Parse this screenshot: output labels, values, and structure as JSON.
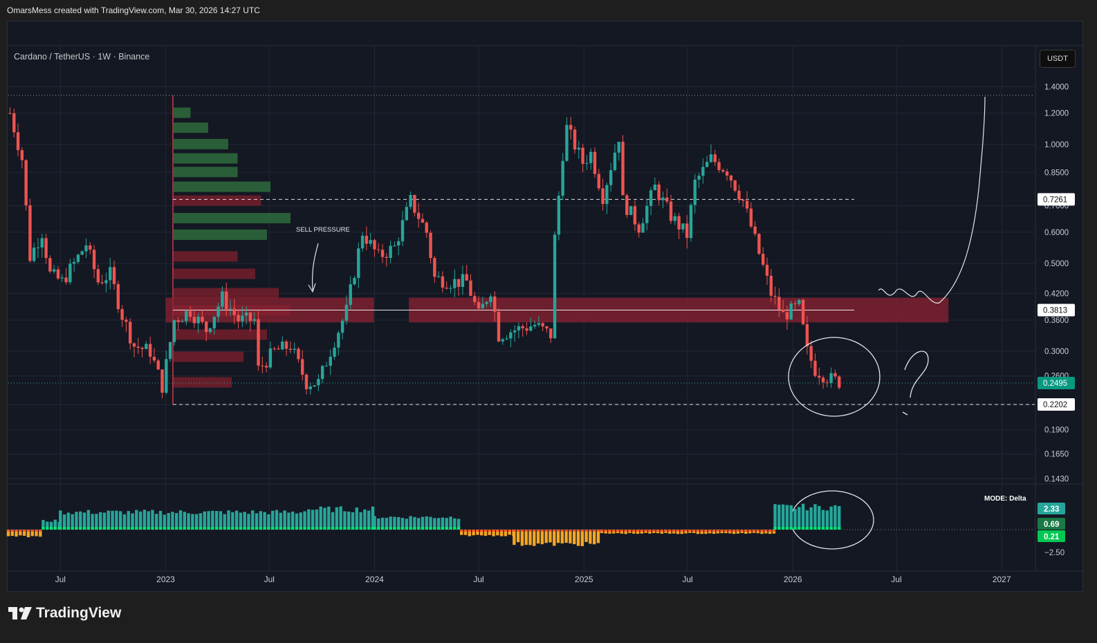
{
  "header": {
    "credit": "OmarsMess created with TradingView.com, Mar 30, 2026 14:27 UTC"
  },
  "symbol": {
    "description": "Cardano / TetherUS · 1W · Binance",
    "currency": "USDT"
  },
  "footer": {
    "brand": "TradingView",
    "logo_icon": "tradingview-logo-icon"
  },
  "colors": {
    "up": "#26a69a",
    "down": "#ef5350",
    "grid": "#232734",
    "zone": "#8b2231",
    "vp_up": "#2e6b3c",
    "vp_down": "#7a1f2c",
    "label_green": "#089981",
    "delta_bright": "#00e676"
  },
  "chart_data": {
    "type": "candlestick",
    "scale": "log",
    "grid": true,
    "symbol": "Cardano / TetherUS",
    "interval": "1W",
    "exchange": "Binance",
    "price_axis_ticks": [
      "1.4000",
      "1.2000",
      "1.0000",
      "0.8500",
      "0.7000",
      "0.6000",
      "0.5000",
      "0.4200",
      "0.3600",
      "0.3000",
      "0.2600",
      "0.2200",
      "0.1900",
      "0.1650",
      "0.1430"
    ],
    "time_axis_labels": [
      {
        "label": "Jul",
        "date": "2022-07"
      },
      {
        "label": "2023",
        "date": "2023-01"
      },
      {
        "label": "Jul",
        "date": "2023-07"
      },
      {
        "label": "2024",
        "date": "2024-01"
      },
      {
        "label": "Jul",
        "date": "2024-07"
      },
      {
        "label": "2025",
        "date": "2025-01"
      },
      {
        "label": "Jul",
        "date": "2025-07"
      },
      {
        "label": "2026",
        "date": "2026-01"
      },
      {
        "label": "Jul",
        "date": "2026-07"
      },
      {
        "label": "2027",
        "date": "2027-01"
      }
    ],
    "price_labels": [
      {
        "value": "0.7261",
        "style": "line"
      },
      {
        "value": "0.3813",
        "style": "line"
      },
      {
        "value": "0.2495",
        "style": "current"
      },
      {
        "value": "0.2202",
        "style": "line"
      }
    ],
    "weekly_close": [
      {
        "x": "2022-04-04",
        "close": 1.2
      },
      {
        "x": "2022-04-25",
        "close": 0.92
      },
      {
        "x": "2022-05-09",
        "close": 0.52
      },
      {
        "x": "2022-05-30",
        "close": 0.6
      },
      {
        "x": "2022-06-13",
        "close": 0.47
      },
      {
        "x": "2022-07-04",
        "close": 0.45
      },
      {
        "x": "2022-07-25",
        "close": 0.5
      },
      {
        "x": "2022-08-15",
        "close": 0.56
      },
      {
        "x": "2022-09-05",
        "close": 0.45
      },
      {
        "x": "2022-09-26",
        "close": 0.47
      },
      {
        "x": "2022-10-17",
        "close": 0.37
      },
      {
        "x": "2022-11-07",
        "close": 0.31
      },
      {
        "x": "2022-12-05",
        "close": 0.3
      },
      {
        "x": "2022-12-26",
        "close": 0.245
      },
      {
        "x": "2023-01-16",
        "close": 0.36
      },
      {
        "x": "2023-02-13",
        "close": 0.38
      },
      {
        "x": "2023-03-13",
        "close": 0.34
      },
      {
        "x": "2023-04-10",
        "close": 0.41
      },
      {
        "x": "2023-05-08",
        "close": 0.36
      },
      {
        "x": "2023-06-05",
        "close": 0.36
      },
      {
        "x": "2023-06-12",
        "close": 0.27
      },
      {
        "x": "2023-07-10",
        "close": 0.3
      },
      {
        "x": "2023-08-07",
        "close": 0.31
      },
      {
        "x": "2023-09-04",
        "close": 0.25
      },
      {
        "x": "2023-09-25",
        "close": 0.25
      },
      {
        "x": "2023-10-23",
        "close": 0.32
      },
      {
        "x": "2023-11-13",
        "close": 0.38
      },
      {
        "x": "2023-12-11",
        "close": 0.6
      },
      {
        "x": "2024-01-08",
        "close": 0.52
      },
      {
        "x": "2024-02-05",
        "close": 0.55
      },
      {
        "x": "2024-03-04",
        "close": 0.72
      },
      {
        "x": "2024-04-01",
        "close": 0.6
      },
      {
        "x": "2024-04-15",
        "close": 0.46
      },
      {
        "x": "2024-05-13",
        "close": 0.45
      },
      {
        "x": "2024-06-10",
        "close": 0.45
      },
      {
        "x": "2024-07-01",
        "close": 0.37
      },
      {
        "x": "2024-07-22",
        "close": 0.43
      },
      {
        "x": "2024-08-05",
        "close": 0.33
      },
      {
        "x": "2024-09-02",
        "close": 0.34
      },
      {
        "x": "2024-10-07",
        "close": 0.35
      },
      {
        "x": "2024-11-04",
        "close": 0.33
      },
      {
        "x": "2024-11-11",
        "close": 0.58
      },
      {
        "x": "2024-11-25",
        "close": 0.95
      },
      {
        "x": "2024-12-02",
        "close": 1.1
      },
      {
        "x": "2024-12-30",
        "close": 0.9
      },
      {
        "x": "2025-01-13",
        "close": 0.95
      },
      {
        "x": "2025-02-03",
        "close": 0.74
      },
      {
        "x": "2025-03-03",
        "close": 1.05
      },
      {
        "x": "2025-03-10",
        "close": 0.72
      },
      {
        "x": "2025-04-07",
        "close": 0.62
      },
      {
        "x": "2025-05-05",
        "close": 0.78
      },
      {
        "x": "2025-06-02",
        "close": 0.66
      },
      {
        "x": "2025-06-30",
        "close": 0.59
      },
      {
        "x": "2025-07-14",
        "close": 0.8
      },
      {
        "x": "2025-08-11",
        "close": 0.92
      },
      {
        "x": "2025-09-08",
        "close": 0.86
      },
      {
        "x": "2025-10-06",
        "close": 0.72
      },
      {
        "x": "2025-10-20",
        "close": 0.62
      },
      {
        "x": "2025-11-03",
        "close": 0.53
      },
      {
        "x": "2025-11-24",
        "close": 0.42
      },
      {
        "x": "2025-12-15",
        "close": 0.37
      },
      {
        "x": "2026-01-12",
        "close": 0.39
      },
      {
        "x": "2026-01-26",
        "close": 0.3
      },
      {
        "x": "2026-02-09",
        "close": 0.27
      },
      {
        "x": "2026-03-09",
        "close": 0.255
      },
      {
        "x": "2026-03-30",
        "close": 0.2495
      }
    ],
    "volume_profile": {
      "price_range": [
        0.2202,
        1.33
      ],
      "up_rows": [
        {
          "price": 1.2,
          "width": 0.15
        },
        {
          "price": 1.1,
          "width": 0.3
        },
        {
          "price": 1.0,
          "width": 0.47
        },
        {
          "price": 0.92,
          "width": 0.55
        },
        {
          "price": 0.85,
          "width": 0.55
        },
        {
          "price": 0.78,
          "width": 0.83
        },
        {
          "price": 0.65,
          "width": 1.0
        },
        {
          "price": 0.59,
          "width": 0.8
        }
      ],
      "down_rows": [
        {
          "price": 0.72,
          "width": 0.75
        },
        {
          "price": 0.52,
          "width": 0.55
        },
        {
          "price": 0.47,
          "width": 0.7
        },
        {
          "price": 0.42,
          "width": 0.9
        },
        {
          "price": 0.38,
          "width": 1.0
        },
        {
          "price": 0.33,
          "width": 0.8
        },
        {
          "price": 0.29,
          "width": 0.6
        },
        {
          "price": 0.25,
          "width": 0.5
        }
      ]
    },
    "zones": [
      {
        "name": "resistance-zone",
        "price_low": 0.355,
        "price_high": 0.41,
        "start": "2024-03-01",
        "end": "2026-09-30"
      },
      {
        "name": "resistance-zone-left",
        "price_low": 0.355,
        "price_high": 0.41,
        "start": "2023-01-01",
        "end": "2023-12-31"
      }
    ],
    "annotations": [
      "SELL PRESSURE",
      "?"
    ],
    "indicator": {
      "mode_label": "MODE: Delta",
      "axis_tick": "−2.50",
      "labels": [
        {
          "value": "2.33",
          "kind": "teal"
        },
        {
          "value": "0.69",
          "kind": "green"
        },
        {
          "value": "0.21",
          "kind": "bright"
        }
      ],
      "series": [
        {
          "start": "2022-04-01",
          "end": "2022-06-01",
          "value": -0.7
        },
        {
          "start": "2022-06-01",
          "end": "2022-07-01",
          "value": 0.9
        },
        {
          "start": "2022-07-01",
          "end": "2023-09-01",
          "value": 1.8
        },
        {
          "start": "2023-09-01",
          "end": "2024-01-01",
          "value": 2.1
        },
        {
          "start": "2024-01-01",
          "end": "2024-06-01",
          "value": 1.3
        },
        {
          "start": "2024-06-01",
          "end": "2024-09-01",
          "value": -0.6
        },
        {
          "start": "2024-09-01",
          "end": "2025-02-01",
          "value": -1.5
        },
        {
          "start": "2025-02-01",
          "end": "2025-12-01",
          "value": -0.4
        },
        {
          "start": "2025-12-01",
          "end": "2026-03-30",
          "value": 2.33
        }
      ]
    }
  }
}
